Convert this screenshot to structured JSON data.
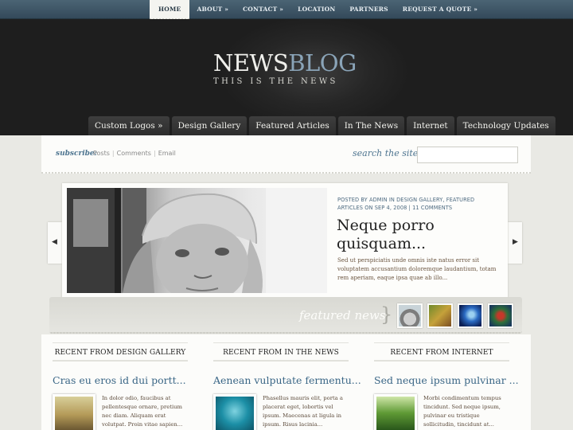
{
  "topnav": {
    "items": [
      "HOME",
      "ABOUT »",
      "CONTACT »",
      "LOCATION",
      "PARTNERS",
      "REQUEST A QUOTE »"
    ]
  },
  "logo": {
    "title_part1": "NEWS",
    "title_part2": "BLOG",
    "tagline": "THIS IS THE NEWS"
  },
  "catnav": {
    "items": [
      "Custom Logos »",
      "Design Gallery",
      "Featured Articles",
      "In The News",
      "Internet",
      "Technology Updates"
    ]
  },
  "subscribe": {
    "label": "subscribe:",
    "links": [
      "Posts",
      "Comments",
      "Email"
    ]
  },
  "search": {
    "label": "search the site",
    "value": ""
  },
  "featured": {
    "meta": "Posted by Admin in Design Gallery, Featured Articles on Sep 4, 2008 | 11 comments",
    "title": "Neque porro quisquam...",
    "excerpt": "Sed ut perspiciatis unde omnis iste natus error sit voluptatem accusantium doloremque laudantium, totam rem aperiam, eaque ipsa quae ab illo...",
    "prev_arrow": "◀",
    "next_arrow": "▶"
  },
  "featured_news": {
    "label": "featured news",
    "brace": "}"
  },
  "recent": [
    {
      "heading": "RECENT FROM DESIGN GALLERY",
      "title": "Cras eu eros id dui portt...",
      "text": "In dolor odio, faucibus at pellentesque ornare, pretium nec diam. Aliquam erat volutpat. Proin vitae sapien..."
    },
    {
      "heading": "RECENT FROM IN THE NEWS",
      "title": "Aenean vulputate fermentu...",
      "text": "Phasellus mauris elit, porta a placerat eget, lobortis vel ipsum. Maecenas at ligula in ipsum. Risus lacinia..."
    },
    {
      "heading": "RECENT FROM INTERNET",
      "title": "Sed neque ipsum pulvinar ...",
      "text": "Morbi condimentum tempus tincidunt. Sed neque ipsum, pulvinar eu tristique sollicitudin, tincidunt at..."
    }
  ]
}
